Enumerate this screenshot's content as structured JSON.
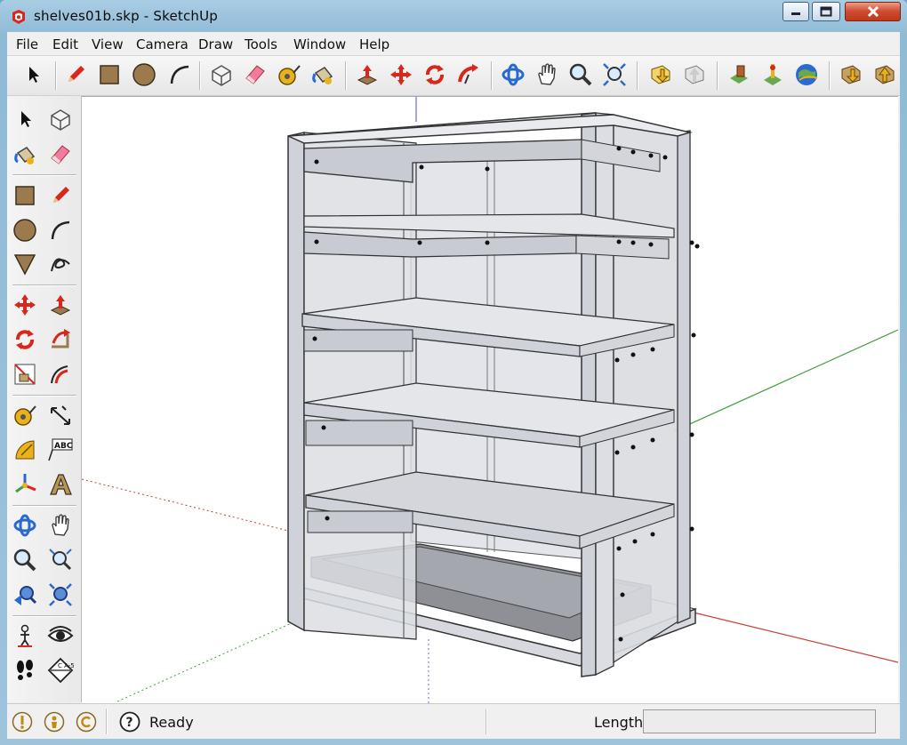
{
  "window": {
    "title": "shelves01b.skp - SketchUp",
    "controls": {
      "minimize": "minimize",
      "maximize": "maximize",
      "close": "close"
    }
  },
  "menubar": {
    "items": [
      {
        "label": "File"
      },
      {
        "label": "Edit"
      },
      {
        "label": "View"
      },
      {
        "label": "Camera"
      },
      {
        "label": "Draw"
      },
      {
        "label": "Tools"
      },
      {
        "label": "Window"
      },
      {
        "label": "Help"
      }
    ]
  },
  "top_toolbar": {
    "tools": [
      "select-icon",
      "pencil-icon",
      "rectangle-icon",
      "circle-icon",
      "arc-icon",
      "make-component-icon",
      "eraser-icon",
      "tape-measure-icon",
      "paint-bucket-icon",
      "push-pull-icon",
      "move-icon",
      "rotate-icon",
      "follow-me-icon",
      "orbit-icon",
      "pan-icon",
      "zoom-icon",
      "zoom-extents-icon",
      "get-models-icon",
      "share-model-icon",
      "add-location-icon",
      "toggle-terrain-icon",
      "google-earth-icon",
      "get-component-icon",
      "share-component-icon"
    ]
  },
  "side_toolbar": {
    "tools": [
      "select-icon",
      "make-component-icon",
      "paint-bucket-icon",
      "eraser-icon",
      "rectangle-icon",
      "pencil-icon",
      "circle-icon",
      "arc-icon",
      "polygon-icon",
      "freehand-icon",
      "move-icon",
      "push-pull-icon",
      "rotate-icon",
      "follow-me-icon",
      "scale-icon",
      "offset-icon",
      "tape-measure-icon",
      "dimension-icon",
      "protractor-icon",
      "text-icon",
      "axes-icon",
      "3d-text-icon",
      "orbit-icon",
      "pan-icon",
      "zoom-icon",
      "zoom-window-icon",
      "previous-view-icon",
      "zoom-extents-icon",
      "position-camera-icon",
      "look-around-icon",
      "walk-icon",
      "section-plane-icon"
    ],
    "text_icon_label": "ABC",
    "section_icon_label": "C A-5"
  },
  "statusbar": {
    "status_text": "Ready",
    "measurement_label": "Length",
    "measurement_value": "",
    "help_icon_glyph": "?"
  },
  "colors": {
    "axis_red": "#c8423a",
    "axis_green": "#3fa03f",
    "axis_blue": "#6a6ad0",
    "model_edge": "#3a3a3a",
    "model_face": "#c9ccd3"
  }
}
